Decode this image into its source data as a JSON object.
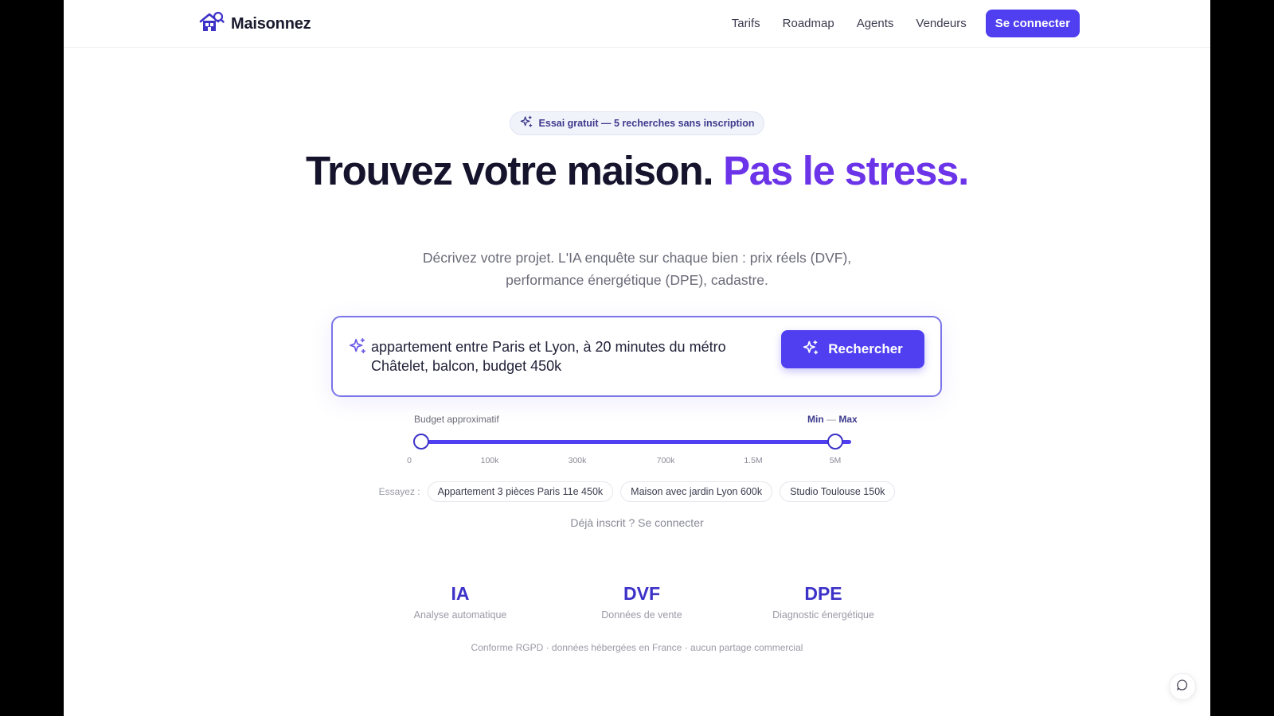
{
  "nav": {
    "brand": "Maisonnez",
    "links": [
      "Tarifs",
      "Roadmap",
      "Agents",
      "Vendeurs"
    ],
    "login": "Se connecter"
  },
  "hero": {
    "badge": "Essai gratuit — 5 recherches sans inscription",
    "headline_main": "Trouvez votre maison.",
    "headline_accent": "Pas le stress.",
    "subtitle_line1": "Décrivez votre projet. L'IA enquête sur chaque bien : prix réels (DVF),",
    "subtitle_line2": "performance énergétique (DPE), cadastre."
  },
  "search": {
    "query_line1": "appartement entre Paris et Lyon, à 20 minutes du métro",
    "query_line2": "Châtelet, balcon, budget 450k",
    "button": "Rechercher"
  },
  "budget": {
    "label": "Budget approximatif",
    "min_label": "Min",
    "separator": "—",
    "max_label": "Max",
    "ticks": [
      "0",
      "100k",
      "300k",
      "700k",
      "1.5M",
      "5M"
    ],
    "selected_min_index": 0,
    "selected_max_index": 5
  },
  "suggestions": {
    "label": "Essayez :",
    "chips": [
      "Appartement 3 pièces Paris 11e 450k",
      "Maison avec jardin Lyon 600k",
      "Studio Toulouse 150k"
    ]
  },
  "already_registered": "Déjà inscrit ? Se connecter",
  "stats": [
    {
      "title": "IA",
      "subtitle": "Analyse automatique"
    },
    {
      "title": "DVF",
      "subtitle": "Données de vente"
    },
    {
      "title": "DPE",
      "subtitle": "Diagnostic énergétique"
    }
  ],
  "footer_note": "Conforme RGPD · données hébergées en France · aucun partage commercial",
  "colors": {
    "primary": "#4f3ff0",
    "accent": "#6c34e8",
    "heading": "#16142d",
    "stat": "#3d32c8"
  },
  "icons": {
    "brand": "house-search-icon",
    "sparkle": "sparkle-icon",
    "chat": "chat-bubble-icon"
  }
}
